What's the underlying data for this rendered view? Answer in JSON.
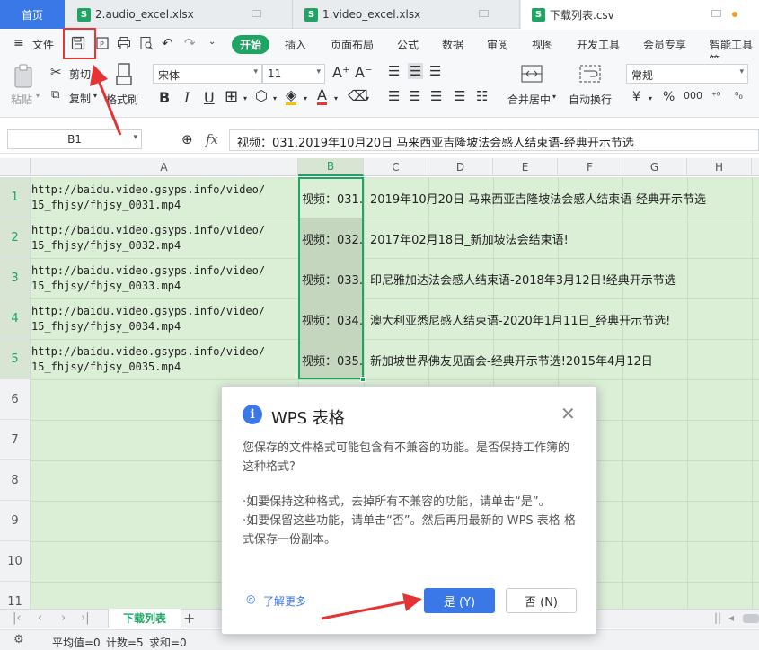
{
  "tabs": {
    "home": "首页",
    "file1": "2.audio_excel.xlsx",
    "file2": "1.video_excel.xlsx",
    "file3": "下载列表.csv",
    "xl_icon": "S"
  },
  "menu": {
    "file": "文件",
    "items": [
      "开始",
      "插入",
      "页面布局",
      "公式",
      "数据",
      "审阅",
      "视图",
      "开发工具",
      "会员专享",
      "智能工具箱"
    ]
  },
  "ribbon": {
    "paste": "粘贴",
    "cut": "剪切",
    "copy": "复制",
    "format_painter": "格式刷",
    "font_name": "宋体",
    "font_size": "11",
    "font_up": "A⁺",
    "font_down": "A⁻",
    "bold": "B",
    "italic": "I",
    "underline": "U",
    "merge_center": "合并居中",
    "wrap_text": "自动换行",
    "number_format": "常规",
    "currency": "¥",
    "percent": "%",
    "thousand": "000",
    "dec_inc": "⁺⁰",
    "dec_dec": "⁰₀"
  },
  "formula_bar": {
    "cell_ref": "B1",
    "fx": "fx",
    "content": "视频：031.2019年10月20日 马来西亚吉隆坡法会感人结束语-经典开示节选"
  },
  "columns": [
    "A",
    "B",
    "C",
    "D",
    "E",
    "F",
    "G",
    "H"
  ],
  "rows": [
    "1",
    "2",
    "3",
    "4",
    "5",
    "6",
    "7",
    "8",
    "9",
    "10",
    "11"
  ],
  "cells": [
    {
      "a1": "http://baidu.video.gsyps.info/video/",
      "a2": "15_fhjsy/fhjsy_0031.mp4",
      "b": "视频：031.",
      "c": "2019年10月20日 马来西亚吉隆坡法会感人结束语-经典开示节选"
    },
    {
      "a1": "http://baidu.video.gsyps.info/video/",
      "a2": "15_fhjsy/fhjsy_0032.mp4",
      "b": "视频：032.",
      "c": "2017年02月18日_新加坡法会结束语!"
    },
    {
      "a1": "http://baidu.video.gsyps.info/video/",
      "a2": "15_fhjsy/fhjsy_0033.mp4",
      "b": "视频：033.",
      "c": "印尼雅加达法会感人结束语-2018年3月12日!经典开示节选"
    },
    {
      "a1": "http://baidu.video.gsyps.info/video/",
      "a2": "15_fhjsy/fhjsy_0034.mp4",
      "b": "视频：034.",
      "c": "澳大利亚悉尼感人结束语-2020年1月11日_经典开示节选!"
    },
    {
      "a1": "http://baidu.video.gsyps.info/video/",
      "a2": "15_fhjsy/fhjsy_0035.mp4",
      "b": "视频：035.",
      "c": "新加坡世界佛友见面会-经典开示节选!2015年4月12日"
    }
  ],
  "sheet": {
    "tab": "下载列表",
    "add": "+"
  },
  "status": {
    "avg": "平均值=0",
    "count": "计数=5",
    "sum": "求和=0"
  },
  "dialog": {
    "title": "WPS 表格",
    "msg1": "您保存的文件格式可能包含有不兼容的功能。是否保持工作簿的这种格式?",
    "msg2": "·如要保持这种格式，去掉所有不兼容的功能，请单击“是”。",
    "msg3": "·如要保留这些功能，请单击“否”。然后再用最新的 WPS 表格 格式保存一份副本。",
    "learn_more": "了解更多",
    "yes": "是 (Y)",
    "no": "否 (N)"
  },
  "colors": {
    "accent": "#1fa463",
    "dialog_btn": "#3b78e7",
    "annotation": "#e33333"
  }
}
